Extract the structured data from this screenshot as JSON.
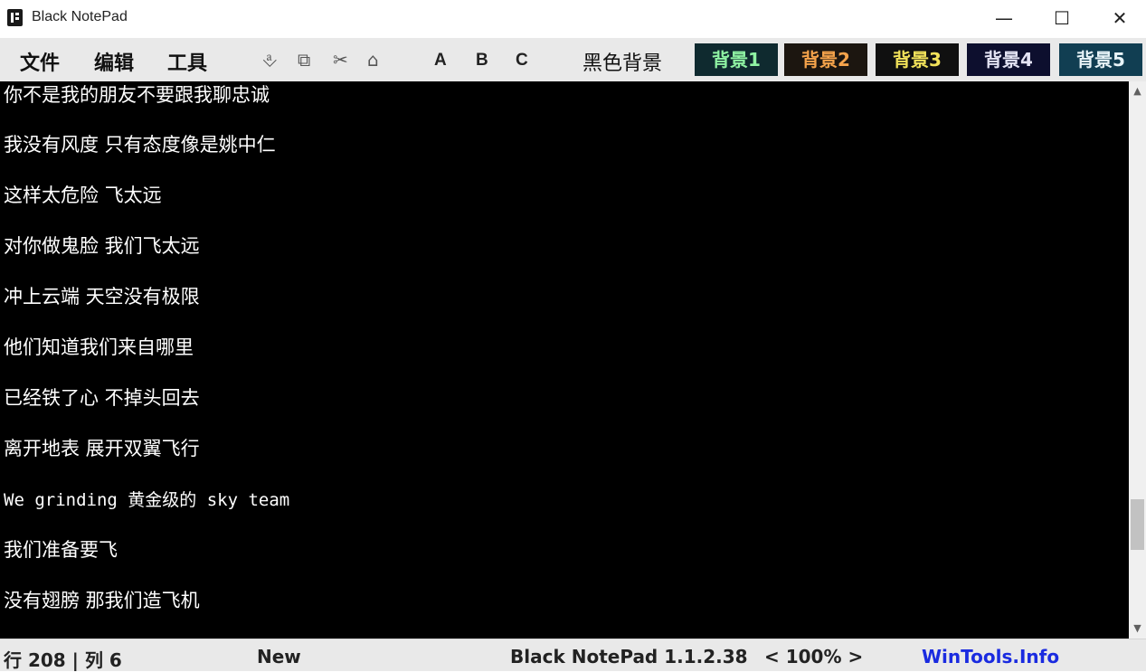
{
  "window": {
    "title": "Black NotePad",
    "minimize_glyph": "—",
    "maximize_glyph": "☐",
    "close_glyph": "✕"
  },
  "menu": {
    "file": "文件",
    "edit": "编辑",
    "tools": "工具"
  },
  "toolbar": {
    "icons": {
      "paste": "⎀",
      "copy": "⧉",
      "cut": "✂",
      "home": "⌂"
    },
    "format": {
      "a": "A",
      "b": "B",
      "c": "C"
    },
    "black_background": "黑色背景",
    "backgrounds": [
      {
        "label": "背景1",
        "bg": "#0f2a2f",
        "fg": "#8ff3a3"
      },
      {
        "label": "背景2",
        "bg": "#1c1610",
        "fg": "#f5a34b"
      },
      {
        "label": "背景3",
        "bg": "#101010",
        "fg": "#f2e25a"
      },
      {
        "label": "背景4",
        "bg": "#0d0f2e",
        "fg": "#e4e4f4"
      },
      {
        "label": "背景5",
        "bg": "#113e52",
        "fg": "#e8f4f8"
      }
    ]
  },
  "editor": {
    "background": "#000000",
    "text_color": "#ffffff",
    "lines": [
      "你不是我的朋友不要跟我聊忠诚",
      "我没有风度 只有态度像是姚中仁",
      "这样太危险 飞太远",
      "对你做鬼脸 我们飞太远",
      "冲上云端 天空没有极限",
      "他们知道我们来自哪里",
      "已经铁了心 不掉头回去",
      "离开地表 展开双翼飞行",
      "We grinding 黄金级的 sky team",
      "我们准备要飞",
      "没有翅膀 那我们造飞机"
    ]
  },
  "scrollbar": {
    "up_glyph": "▲",
    "down_glyph": "▼",
    "position_fraction": 0.85
  },
  "status": {
    "position": "行 208 | 列 6",
    "file_state": "New",
    "version": "Black NotePad 1.1.2.38",
    "zoom": "< 100% >",
    "site": "WinTools.Info",
    "site_color": "#1a2be0"
  }
}
